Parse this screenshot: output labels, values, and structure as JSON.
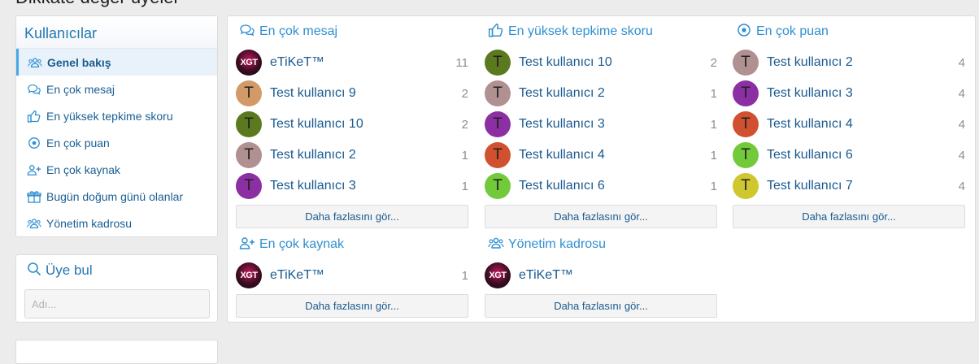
{
  "page": {
    "title": "Dikkate değer üyeler"
  },
  "sidebar": {
    "title": "Kullanıcılar",
    "items": [
      {
        "label": "Genel bakış",
        "icon": "users-icon",
        "active": true
      },
      {
        "label": "En çok mesaj",
        "icon": "comments-icon"
      },
      {
        "label": "En yüksek tepkime skoru",
        "icon": "thumbs-up-icon"
      },
      {
        "label": "En çok puan",
        "icon": "dot-circle-icon"
      },
      {
        "label": "En çok kaynak",
        "icon": "user-plus-icon"
      },
      {
        "label": "Bugün doğum günü olanlar",
        "icon": "gift-icon"
      },
      {
        "label": "Yönetim kadrosu",
        "icon": "users-icon"
      }
    ]
  },
  "find_member": {
    "title": "Üye bul",
    "placeholder": "Adı..."
  },
  "more_label": "Daha fazlasını gör...",
  "cards": [
    {
      "title": "En çok mesaj",
      "icon": "comments-icon",
      "members": [
        {
          "name": "eTiKeT™",
          "count": "11",
          "avatar": "logo",
          "logo_text": "XGT"
        },
        {
          "name": "Test kullanıcı 9",
          "count": "2",
          "initial": "T",
          "color": "#d29a68"
        },
        {
          "name": "Test kullanıcı 10",
          "count": "2",
          "initial": "T",
          "color": "#5b7a1f"
        },
        {
          "name": "Test kullanıcı 2",
          "count": "1",
          "initial": "T",
          "color": "#b09090"
        },
        {
          "name": "Test kullanıcı 3",
          "count": "1",
          "initial": "T",
          "color": "#8b2fa3"
        }
      ]
    },
    {
      "title": "En yüksek tepkime skoru",
      "icon": "thumbs-up-icon",
      "members": [
        {
          "name": "Test kullanıcı 10",
          "count": "2",
          "initial": "T",
          "color": "#5b7a1f"
        },
        {
          "name": "Test kullanıcı 2",
          "count": "1",
          "initial": "T",
          "color": "#b09090"
        },
        {
          "name": "Test kullanıcı 3",
          "count": "1",
          "initial": "T",
          "color": "#8b2fa3"
        },
        {
          "name": "Test kullanıcı 4",
          "count": "1",
          "initial": "T",
          "color": "#d0502f"
        },
        {
          "name": "Test kullanıcı 6",
          "count": "1",
          "initial": "T",
          "color": "#72c93a"
        }
      ]
    },
    {
      "title": "En çok puan",
      "icon": "dot-circle-icon",
      "members": [
        {
          "name": "Test kullanıcı 2",
          "count": "4",
          "initial": "T",
          "color": "#b09090"
        },
        {
          "name": "Test kullanıcı 3",
          "count": "4",
          "initial": "T",
          "color": "#8b2fa3"
        },
        {
          "name": "Test kullanıcı 4",
          "count": "4",
          "initial": "T",
          "color": "#d0502f"
        },
        {
          "name": "Test kullanıcı 6",
          "count": "4",
          "initial": "T",
          "color": "#72c93a"
        },
        {
          "name": "Test kullanıcı 7",
          "count": "4",
          "initial": "T",
          "color": "#cfc72f"
        }
      ]
    },
    {
      "title": "En çok kaynak",
      "icon": "user-plus-icon",
      "members": [
        {
          "name": "eTiKeT™",
          "count": "1",
          "avatar": "logo",
          "logo_text": "XGT"
        }
      ]
    },
    {
      "title": "Yönetim kadrosu",
      "icon": "users-icon",
      "members": [
        {
          "name": "eTiKeT™",
          "count": "",
          "avatar": "logo",
          "logo_text": "XGT"
        }
      ]
    }
  ]
}
